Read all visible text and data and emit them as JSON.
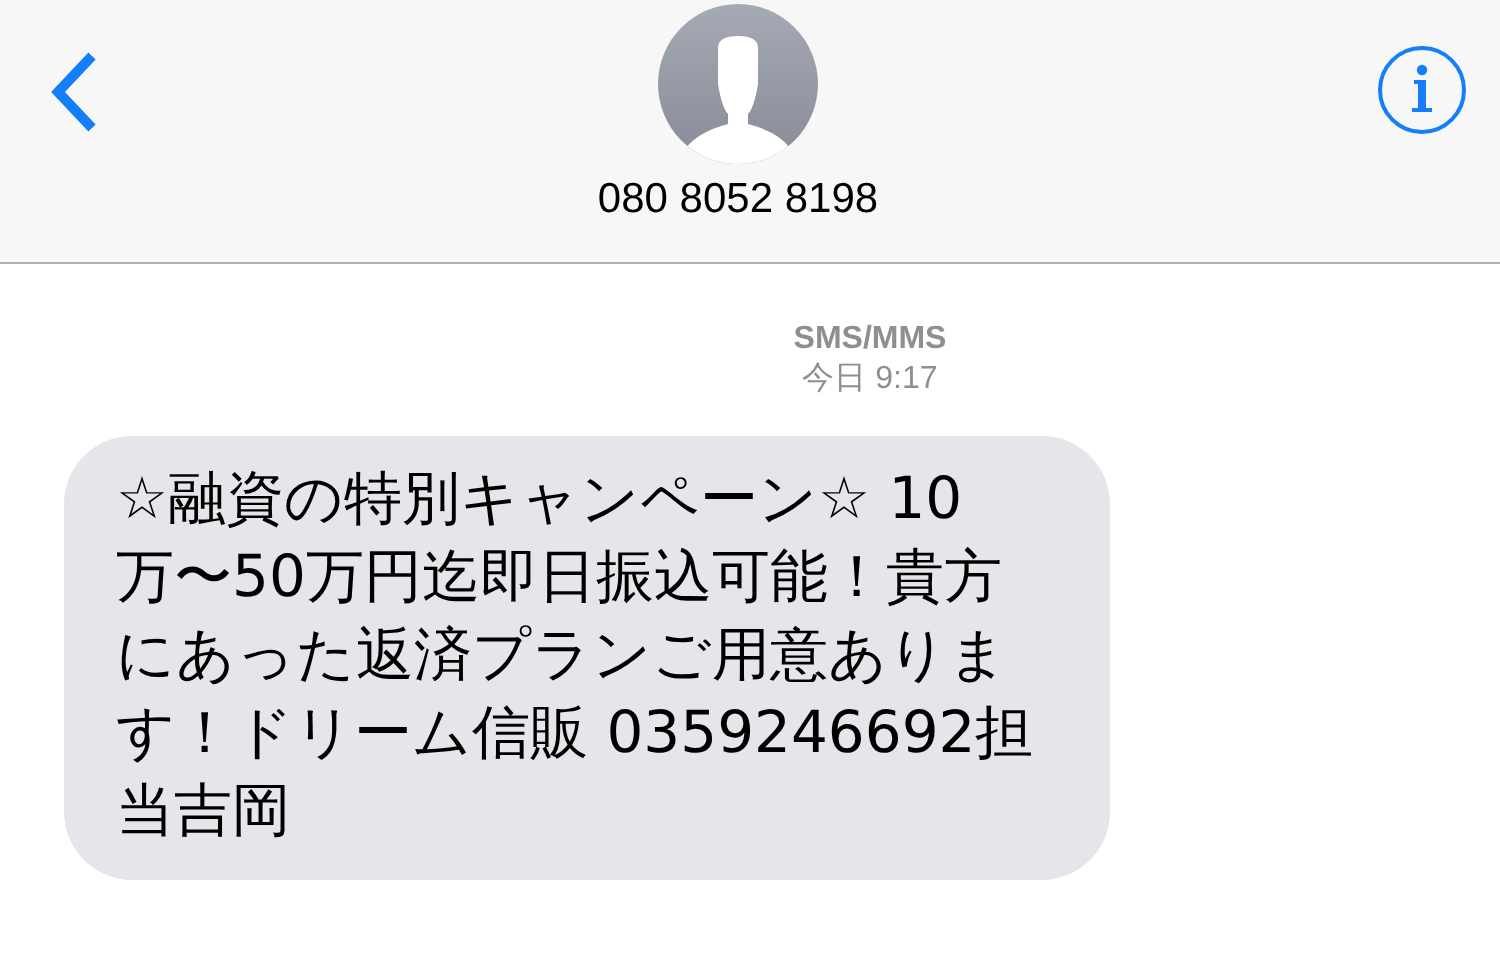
{
  "header": {
    "contact": "080 8052 8198"
  },
  "thread": {
    "service": "SMS/MMS",
    "timestamp": "今日 9:17"
  },
  "messages": [
    {
      "kind": "incoming",
      "text": "☆融資の特別キャンペーン☆ 10万〜50万円迄即日振込可能！貴方にあった返済プランご用意あります！ドリーム信販 0359246692担当吉岡"
    }
  ]
}
